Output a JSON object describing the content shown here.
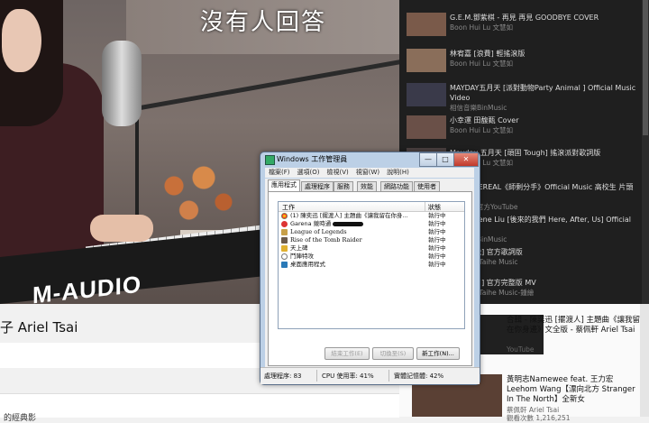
{
  "video": {
    "lyric": "沒有人回答",
    "keyboard_brand": "M-AUDIO",
    "title": "子 Ariel Tsai"
  },
  "below": {
    "text": "的經典影"
  },
  "recommendations_dark": [
    {
      "title": "G.E.M.鄧紫棋 - 再見 再見 GOODBYE COVER",
      "channel": "Boon Hui Lu 文慧如"
    },
    {
      "title": "林宥嘉 [浪費] 輕搖滾版",
      "channel": "Boon Hui Lu 文慧如"
    },
    {
      "title": "MAYDAY五月天 [派對動物Party Animal ] Official Music Video",
      "channel": "相信音樂BinMusic"
    },
    {
      "title": "小幸運 田馥甄 Cover",
      "channel": "Boon Hui Lu 文慧如"
    },
    {
      "title": "Mayday 五月天 [頑固 Tough] 搖滾派對歌詞版",
      "channel": "Boon Hui Lu 文慧如"
    },
    {
      "title": "LOCKTHEREAL《師剩分手》Official Music 高校生 片頭曲",
      "channel": "台北台灣官方YouTube"
    },
    {
      "title": "劉若英 Rene Liu [後來的我們 Here, After, Us] Official",
      "channel": "相信音樂BinMusic"
    },
    {
      "title": "[愛的可能] 官方歌詞版",
      "channel": "華納音樂 Taihe Music"
    },
    {
      "title": "[不要忘了] 官方完整版 MV",
      "channel": "華納音樂 Taihe Music-鍾繪"
    }
  ],
  "recommendations_light": [
    {
      "title": "合輯 - 陳奕迅 [擺渡人] 主題曲《讓我留在你身邊》文全版 - 蔡佩軒 Ariel Tsai",
      "channel": "YouTube"
    },
    {
      "title": "黃明志Namewee feat. 王力宏 Leehom Wang【漂向北方 Stranger In The North】全新女",
      "channel": "蔡佩軒 Ariel Tsai",
      "meta": "觀看次數 1,216,251"
    }
  ],
  "taskmgr": {
    "title": "Windows 工作管理員",
    "controls": {
      "min": "—",
      "max": "□",
      "close": "✕"
    },
    "menu": [
      "檔案(F)",
      "選項(O)",
      "檢視(V)",
      "視窗(W)",
      "說明(H)"
    ],
    "tabs": [
      "應用程式",
      "處理程序",
      "服務",
      "效能",
      "網路功能",
      "使用者"
    ],
    "columns": {
      "task": "工作",
      "status": "狀態"
    },
    "rows": [
      {
        "name": "(1) 陳奕迅 [擺渡人] 主題曲《讓我留在你身...",
        "status": "執行中"
      },
      {
        "name": "Garena 競時通 - ",
        "status": "執行中"
      },
      {
        "name": "League of Legends",
        "status": "執行中"
      },
      {
        "name": "Rise of the Tomb Raider",
        "status": "執行中"
      },
      {
        "name": "天上碑",
        "status": "執行中"
      },
      {
        "name": "鬥陣特攻",
        "status": "執行中"
      },
      {
        "name": "桌面應用程式",
        "status": "執行中"
      }
    ],
    "buttons": {
      "end_task": "結束工作(E)",
      "switch_to": "切換至(S)",
      "new_task": "新工作(N)..."
    },
    "status_bar": {
      "processes": "處理程序: 83",
      "cpu": "CPU 使用率: 41%",
      "memory": "實體記憶體: 42%"
    }
  }
}
